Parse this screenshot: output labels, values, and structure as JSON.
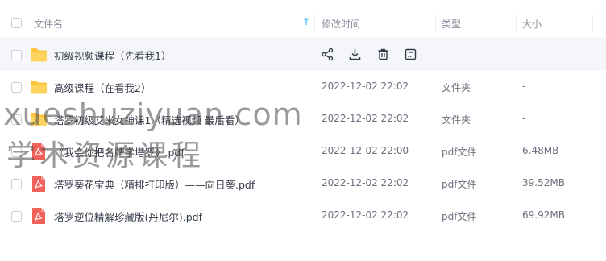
{
  "header": {
    "name_col": "文件名",
    "sort_arrow": "↑",
    "modified_col": "修改时间",
    "type_col": "类型",
    "size_col": "大小"
  },
  "actions": [
    "share-icon",
    "download-icon",
    "delete-icon",
    "more-icon"
  ],
  "rows": [
    {
      "name": "初级视频课程（先看我1）",
      "icon": "folder-icon",
      "modified": "",
      "type": "",
      "size": ""
    },
    {
      "name": "高级课程（在看我2）",
      "icon": "folder-icon",
      "modified": "2022-12-02 22:02",
      "type": "文件夹",
      "size": "-"
    },
    {
      "name": "塔罗初级艾米女神课1（精选视频 最后看）",
      "icon": "folder-icon",
      "modified": "2022-12-02 22:02",
      "type": "文件夹",
      "size": "-"
    },
    {
      "name": "《我会你把名牌学塔罗》.pdf",
      "icon": "pdf-icon",
      "modified": "2022-12-02 22:00",
      "type": "pdf文件",
      "size": "6.48MB"
    },
    {
      "name": "塔罗葵花宝典（精排打印版）——向日葵.pdf",
      "icon": "pdf-icon",
      "modified": "2022-12-02 22:02",
      "type": "pdf文件",
      "size": "39.52MB"
    },
    {
      "name": "塔罗逆位精解珍藏版(丹尼尔).pdf",
      "icon": "pdf-icon",
      "modified": "2022-12-02 22:02",
      "type": "pdf文件",
      "size": "69.92MB"
    }
  ],
  "watermark": {
    "line1": "xueshuziyuan.com",
    "line2": "学术资源课程"
  },
  "colors": {
    "folder": "#ffc53d",
    "pdf": "#f0625b",
    "accent": "#06a7ff",
    "hover_row": "#f5f6fa"
  }
}
